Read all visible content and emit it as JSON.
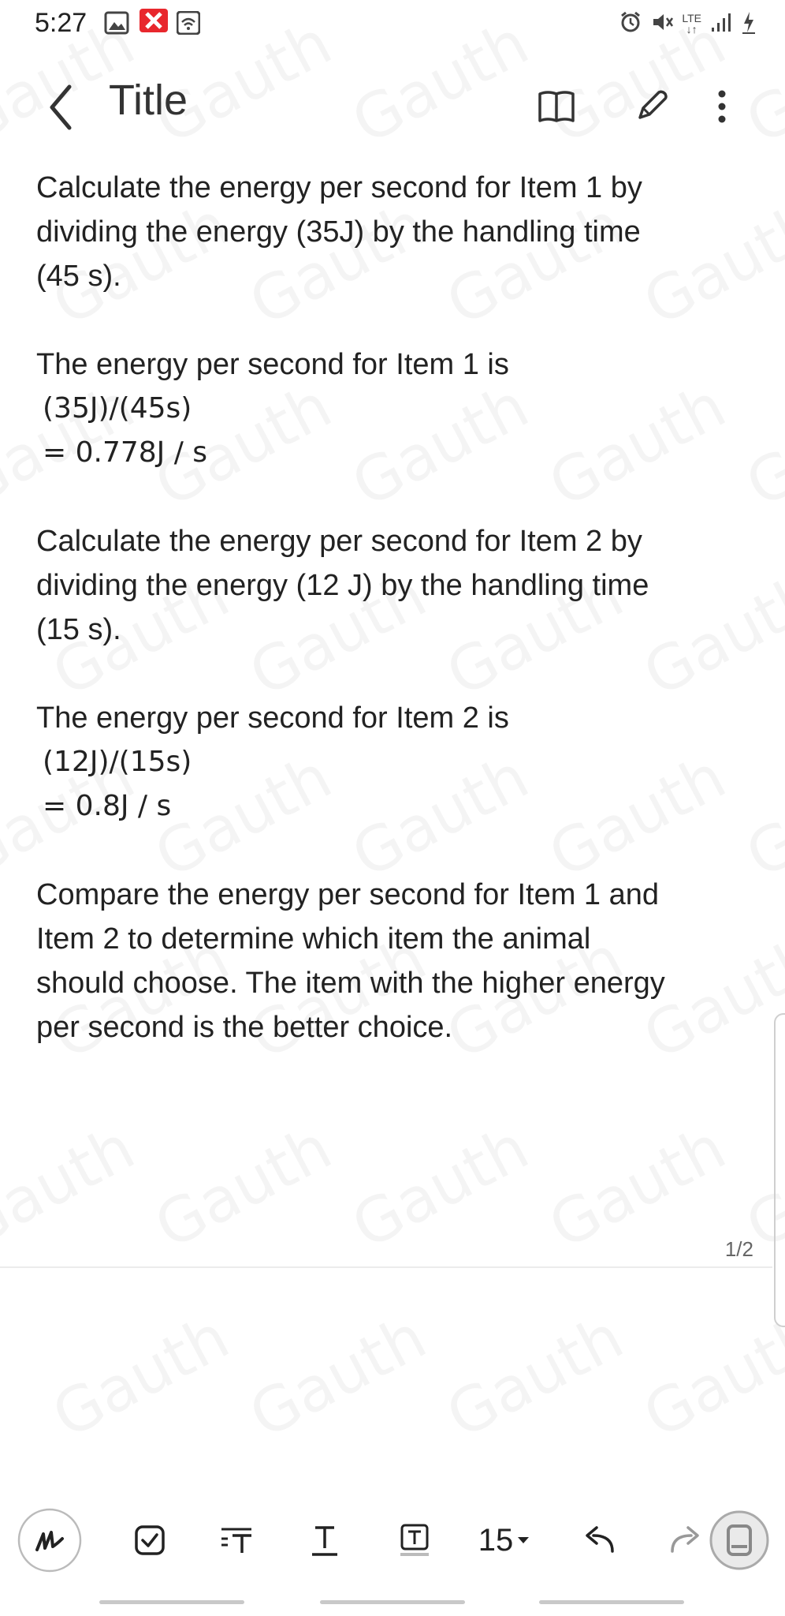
{
  "status_bar": {
    "time": "5:27",
    "network": "LTE"
  },
  "header": {
    "title": "Title"
  },
  "content": {
    "paragraphs": [
      {
        "lines": [
          "Calculate the energy per second for Item 1 by",
          "dividing the energy (35J) by the handling time",
          "(45 s)."
        ]
      },
      {
        "lines": [
          "The energy per second for Item 1 is"
        ],
        "math": [
          "(35J)/(45s)",
          "= 0.778J / s"
        ]
      },
      {
        "lines": [
          "Calculate the energy per second for Item 2 by",
          "dividing the energy (12 J) by the handling time",
          "(15 s)."
        ]
      },
      {
        "lines": [
          "The energy per second for Item 2 is"
        ],
        "math": [
          "(12J)/(15s)",
          "= 0.8J / s"
        ]
      },
      {
        "lines": [
          "Compare the energy per second for Item 1 and",
          "Item 2 to determine which item the animal",
          "should choose. The item with the higher energy",
          "per second is the better choice."
        ]
      }
    ]
  },
  "page_indicator": "1/2",
  "toolbar": {
    "font_size": "15"
  },
  "watermark": "Gauth"
}
